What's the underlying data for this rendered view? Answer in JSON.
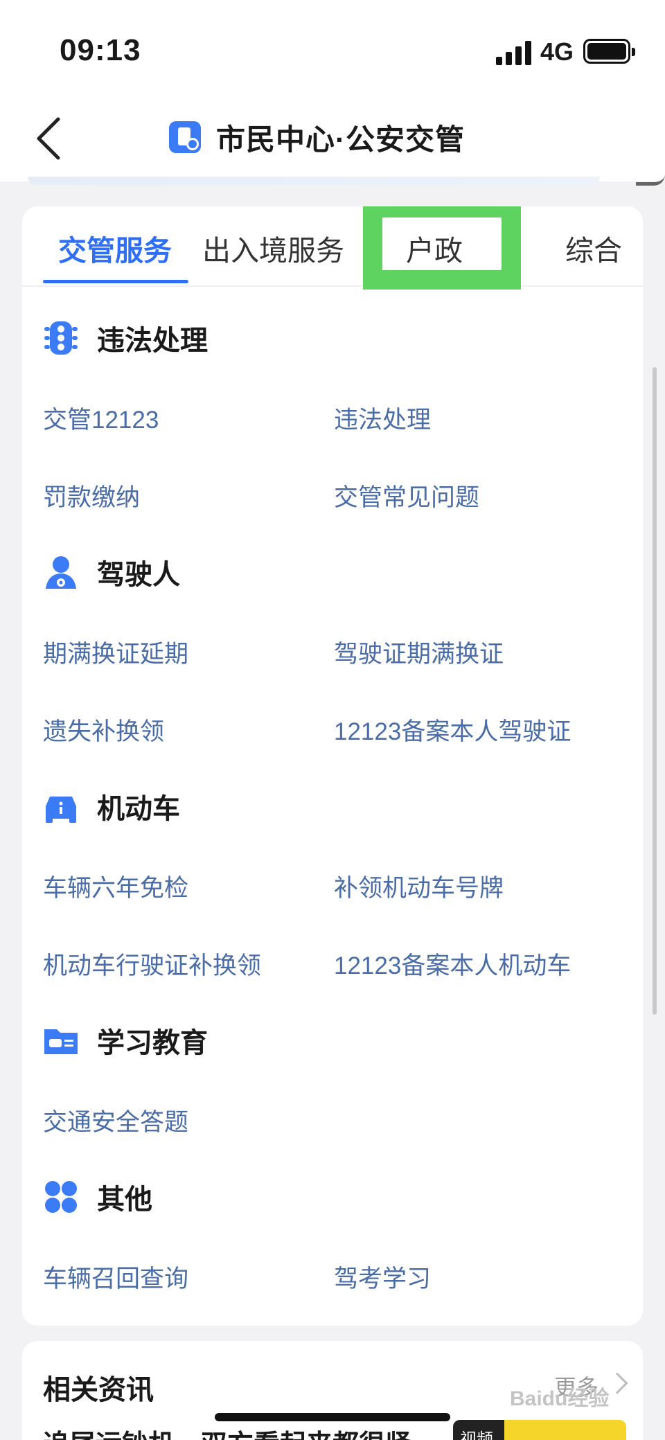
{
  "status_bar": {
    "time": "09:13",
    "network": "4G"
  },
  "nav": {
    "title": "市民中心·公安交管"
  },
  "tabs": [
    {
      "label": "交管服务",
      "active": true
    },
    {
      "label": "出入境服务",
      "active": false
    },
    {
      "label": "户政",
      "active": false
    },
    {
      "label": "综合",
      "active": false
    }
  ],
  "sections": [
    {
      "title": "违法处理",
      "icon": "traffic-light-icon",
      "links": [
        "交管12123",
        "违法处理",
        "罚款缴纳",
        "交管常见问题"
      ]
    },
    {
      "title": "驾驶人",
      "icon": "driver-icon",
      "links": [
        "期满换证延期",
        "驾驶证期满换证",
        "遗失补换领",
        "12123备案本人驾驶证"
      ]
    },
    {
      "title": "机动车",
      "icon": "car-icon",
      "links": [
        "车辆六年免检",
        "补领机动车号牌",
        "机动车行驶证补换领",
        "12123备案本人机动车"
      ]
    },
    {
      "title": "学习教育",
      "icon": "folder-car-icon",
      "links": [
        "交通安全答题"
      ]
    },
    {
      "title": "其他",
      "icon": "grid-icon",
      "links": [
        "车辆召回查询",
        "驾考学习"
      ]
    }
  ],
  "news": {
    "title": "相关资讯",
    "more": "更多",
    "first_headline": "追尾运钞机，双方看起来都很紧",
    "video_tag": "视频"
  },
  "colors": {
    "accent": "#2e6ff5",
    "link": "#4a6da8",
    "highlight": "#5fd35f"
  },
  "watermark": "Baidu经验"
}
